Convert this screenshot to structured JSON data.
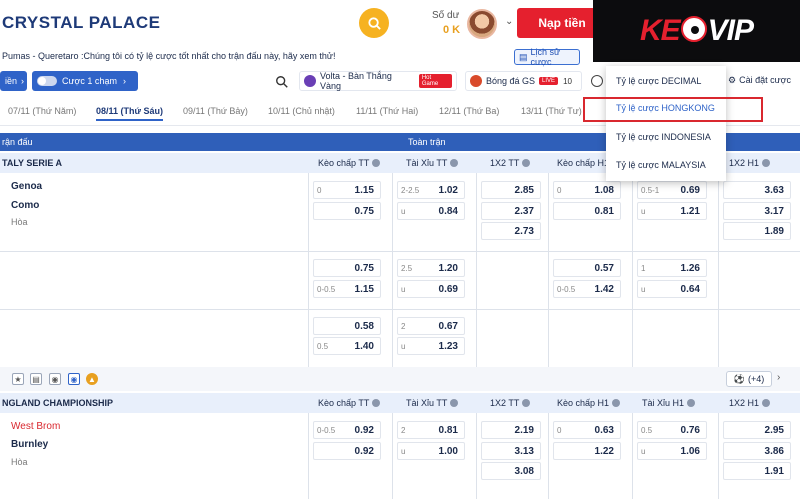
{
  "header": {
    "brand": "CRYSTAL PALACE",
    "balance_label": "Số dư",
    "balance_value": "0 K",
    "deposit_label": "Nạp tiền"
  },
  "logo": {
    "text_a": "KE",
    "text_b": "VIP"
  },
  "ticker": "Pumas - Queretaro :Chúng tôi có tỷ lệ cược tốt nhất cho trận đấu này, hãy xem thử!",
  "history_label": "Lịch sử cược",
  "toolbar": {
    "chip1": "iền",
    "chip2": "Cược 1 chạm",
    "volta_label": "Volta - Bàn Thắng Vàng",
    "volta_badge": "Hot Game",
    "gs_label": "Bóng đá GS",
    "gs_badge": "LIVE",
    "gs_count": "10",
    "settings": "Cài đặt cược"
  },
  "dates": [
    "07/11 (Thứ Năm)",
    "08/11 (Thứ Sáu)",
    "09/11 (Thứ Bảy)",
    "10/11 (Chủ nhật)",
    "11/11 (Thứ Hai)",
    "12/11 (Thứ Ba)",
    "13/11 (Thứ Tư)"
  ],
  "dropdown": {
    "items": [
      "Tỷ lệ cược DECIMAL",
      "Tỷ lệ cược HONGKONG",
      "Tỷ lệ cược INDONESIA",
      "Tỷ lệ cược MALAYSIA"
    ]
  },
  "table": {
    "match_header": "rận đấu",
    "full_header": "Toàn trận",
    "columns": [
      "Kèo chấp TT",
      "Tài Xỉu TT",
      "1X2 TT",
      "Kèo chấp H1",
      "Tài Xỉu H1",
      "1X2 H1"
    ],
    "leagues": [
      {
        "name": "TALY SERIE A",
        "home": "Genoa",
        "away": "Como",
        "draw": "Hòa",
        "rows": [
          {
            "hc_handicap": [
              "0",
              ""
            ],
            "hc_odds": [
              "1.15",
              "0.75"
            ],
            "ou_line": [
              "2-2.5",
              "u"
            ],
            "ou_odds": [
              "1.02",
              "0.84"
            ],
            "x12": [
              "2.85",
              "2.37",
              "2.73"
            ],
            "h1_hc_line": [
              "0",
              ""
            ],
            "h1_hc": [
              "1.08",
              "0.81"
            ],
            "h1_ou_line": [
              "0.5-1",
              "u"
            ],
            "h1_ou": [
              "0.69",
              "1.21"
            ],
            "h1_x12": [
              "3.63",
              "3.17",
              "1.89"
            ]
          },
          {
            "hc_handicap": [
              "",
              "0-0.5"
            ],
            "hc_odds": [
              "0.75",
              "1.15"
            ],
            "ou_line": [
              "2.5",
              "u"
            ],
            "ou_odds": [
              "1.20",
              "0.69"
            ],
            "h1_hc_line": [
              "",
              "0-0.5"
            ],
            "h1_hc": [
              "0.57",
              "1.42"
            ],
            "h1_ou_line": [
              "1",
              "u"
            ],
            "h1_ou": [
              "1.26",
              "0.64"
            ]
          },
          {
            "hc_handicap": [
              "",
              "0.5"
            ],
            "hc_odds": [
              "0.58",
              "1.40"
            ],
            "ou_line": [
              "2",
              "u"
            ],
            "ou_odds": [
              "0.67",
              "1.23"
            ]
          }
        ]
      },
      {
        "name": "NGLAND CHAMPIONSHIP",
        "home": "West Brom",
        "away": "Burnley",
        "draw": "Hòa",
        "rows": [
          {
            "hc_handicap": [
              "0-0.5",
              ""
            ],
            "hc_odds": [
              "0.92",
              "0.92"
            ],
            "ou_line": [
              "2",
              "u"
            ],
            "ou_odds": [
              "0.81",
              "1.00"
            ],
            "x12": [
              "2.19",
              "3.13",
              "3.08"
            ],
            "h1_hc_line": [
              "0",
              ""
            ],
            "h1_hc": [
              "0.63",
              "1.22"
            ],
            "h1_ou_line": [
              "0.5",
              "u"
            ],
            "h1_ou": [
              "0.76",
              "1.06"
            ],
            "h1_x12": [
              "2.95",
              "3.86",
              "1.91"
            ]
          }
        ]
      }
    ],
    "more_label": "(+4)"
  }
}
